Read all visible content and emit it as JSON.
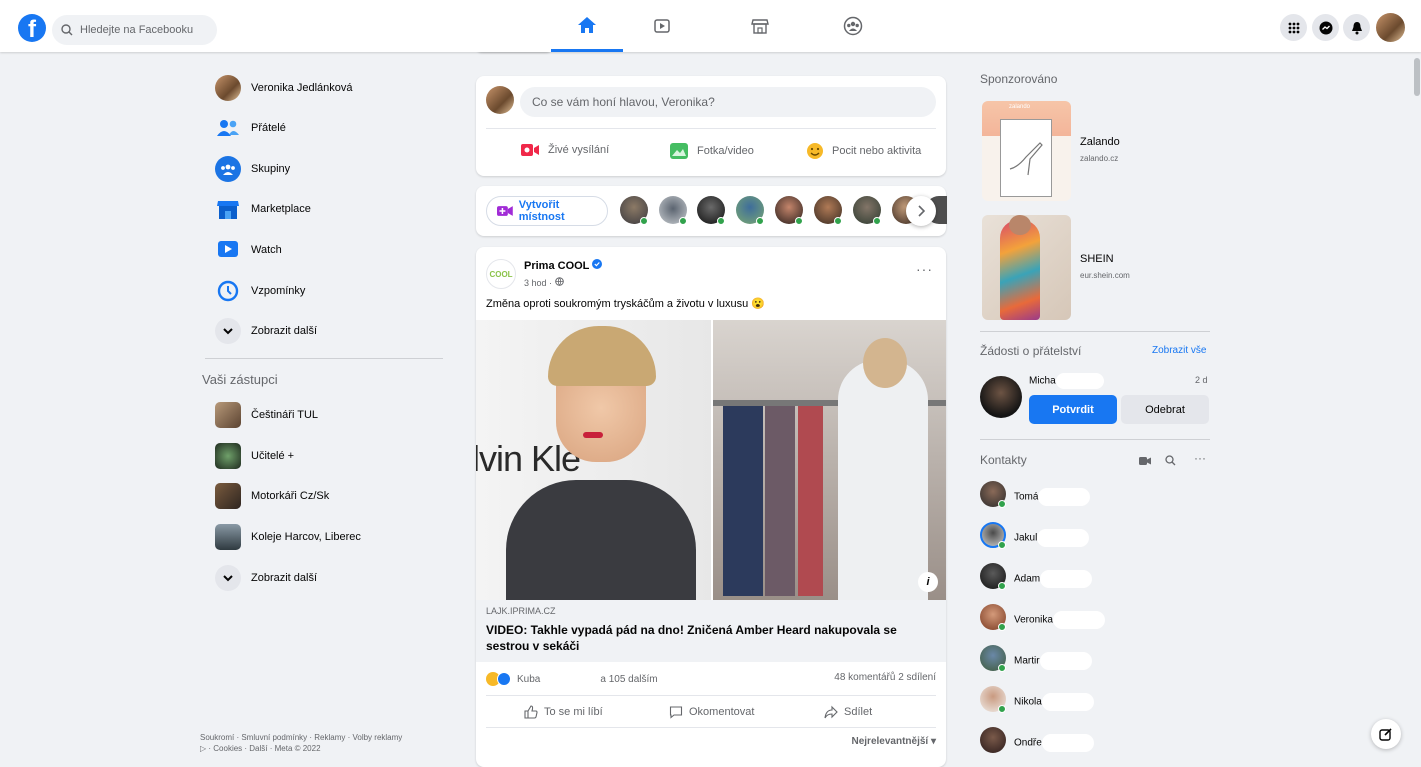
{
  "header": {
    "logo_letter": "f",
    "search_placeholder": "Hledejte na Facebooku",
    "nav_icons": [
      "home-icon",
      "watch-icon",
      "marketplace-icon",
      "groups-icon"
    ],
    "accent": "#1877f2"
  },
  "left_nav": {
    "items": [
      {
        "label": "Veronika Jedlánková",
        "icon": "avatar"
      },
      {
        "label": "Přátelé",
        "icon": "friends-icon"
      },
      {
        "label": "Skupiny",
        "icon": "groups-icon"
      },
      {
        "label": "Marketplace",
        "icon": "marketplace-icon"
      },
      {
        "label": "Watch",
        "icon": "watch-icon"
      },
      {
        "label": "Vzpomínky",
        "icon": "memories-icon"
      },
      {
        "label": "Zobrazit další",
        "icon": "chevron-down-icon"
      }
    ],
    "shortcuts_title": "Vaši zástupci",
    "shortcuts": [
      {
        "label": "Češtináři TUL"
      },
      {
        "label": "Učitelé +"
      },
      {
        "label": "Motorkáři Cz/Sk"
      },
      {
        "label": "Koleje Harcov, Liberec"
      },
      {
        "label": "Zobrazit další"
      }
    ],
    "footer_line1": "Soukromí · Smluvní podmínky · Reklamy · Volby reklamy",
    "footer_line2": "▷ · Cookies · Další · Meta © 2022"
  },
  "composer": {
    "placeholder": "Co se vám honí hlavou, Veronika?",
    "live_label": "Živé vysílání",
    "photo_label": "Fotka/video",
    "feeling_label": "Pocit nebo aktivita"
  },
  "rooms": {
    "create_label": "Vytvořit místnost"
  },
  "post": {
    "page_name": "Prima COOL",
    "page_logo_text": "COOL",
    "time": "3 hod · ",
    "text": "Změna oproti soukromým tryskáčům a životu v luxusu 😮",
    "image_text": "lvin Kle",
    "link_domain": "LAJK.IPRIMA.CZ",
    "link_title": "VIDEO: Takhle vypadá pád na dno! Zničená Amber Heard nakupovala se sestrou v sekáči",
    "reactions_text_a": "Kuba",
    "reactions_text_b": "a 105 dalším",
    "comments_shares": "48 komentářů  2 sdílení",
    "like_label": "To se mi líbí",
    "comment_label": "Okomentovat",
    "share_label": "Sdílet",
    "sort_label": "Nejrelevantnější ▾"
  },
  "sponsored": {
    "title": "Sponzorováno",
    "ads": [
      {
        "name": "Zalando",
        "domain": "zalando.cz",
        "brand_text": "zalando"
      },
      {
        "name": "SHEIN",
        "domain": "eur.shein.com"
      }
    ]
  },
  "friend_requests": {
    "title": "Žádosti o přátelství",
    "see_all": "Zobrazit vše",
    "name": "Micha",
    "age": "2 d",
    "confirm_label": "Potvrdit",
    "remove_label": "Odebrat"
  },
  "contacts": {
    "title": "Kontakty",
    "items": [
      "Tomá",
      "Jakul",
      "Adam",
      "Veronika",
      "Martir",
      "Nikola",
      "Ondře"
    ]
  }
}
